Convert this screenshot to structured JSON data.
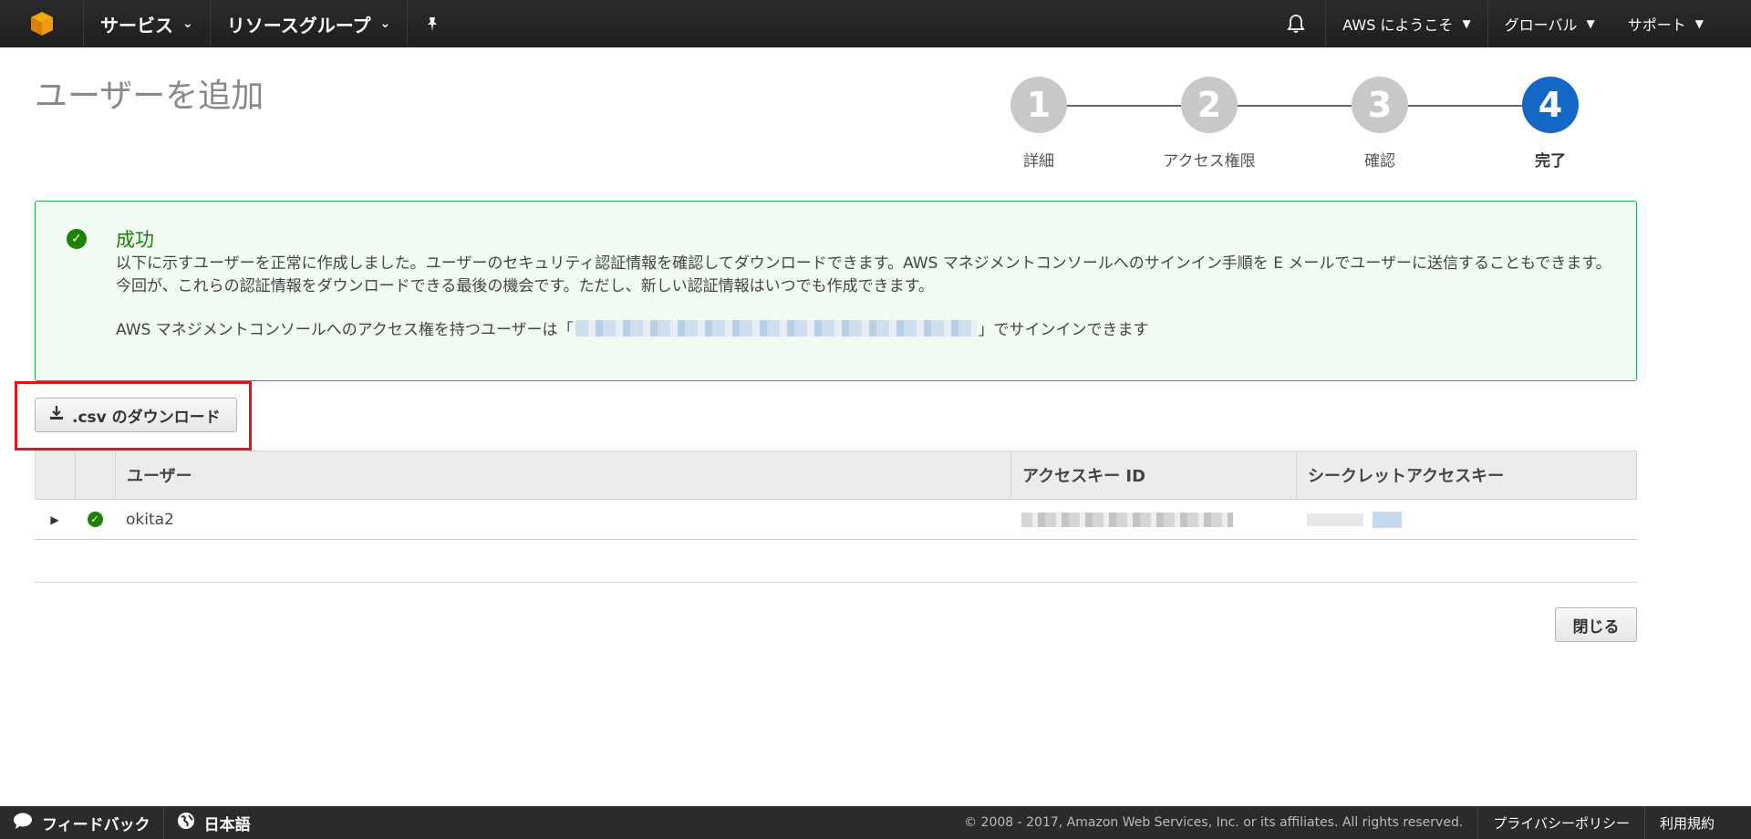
{
  "nav": {
    "services": "サービス",
    "resource_groups": "リソースグループ",
    "account": "AWS にようこそ",
    "region": "グローバル",
    "support": "サポート"
  },
  "page": {
    "title": "ユーザーを追加"
  },
  "steps": [
    {
      "number": "1",
      "label": "詳細",
      "active": false
    },
    {
      "number": "2",
      "label": "アクセス権限",
      "active": false
    },
    {
      "number": "3",
      "label": "確認",
      "active": false
    },
    {
      "number": "4",
      "label": "完了",
      "active": true
    }
  ],
  "success": {
    "title": "成功",
    "description": "以下に示すユーザーを正常に作成しました。ユーザーのセキュリティ認証情報を確認してダウンロードできます。AWS マネジメントコンソールへのサインイン手順を E メールでユーザーに送信することもできます。今回が、これらの認証情報をダウンロードできる最後の機会です。ただし、新しい認証情報はいつでも作成できます。",
    "signin_prefix": "AWS マネジメントコンソールへのアクセス権を持つユーザーは「",
    "signin_suffix": "」でサインインできます"
  },
  "download": {
    "label": ".csv のダウンロード"
  },
  "table": {
    "headers": {
      "user": "ユーザー",
      "access_key_id": "アクセスキー ID",
      "secret_access_key": "シークレットアクセスキー"
    },
    "rows": [
      {
        "user": "okita2"
      }
    ]
  },
  "actions": {
    "close": "閉じる"
  },
  "footer": {
    "feedback": "フィードバック",
    "language": "日本語",
    "copyright": "© 2008 - 2017, Amazon Web Services, Inc. or its affiliates. All rights reserved.",
    "privacy": "プライバシーポリシー",
    "terms": "利用規約"
  },
  "colors": {
    "nav_bg": "#232323",
    "step_active": "#1467c4",
    "step_inactive": "#c8c8c8",
    "success_green": "#1d8102",
    "highlight_red": "#e4141b"
  }
}
